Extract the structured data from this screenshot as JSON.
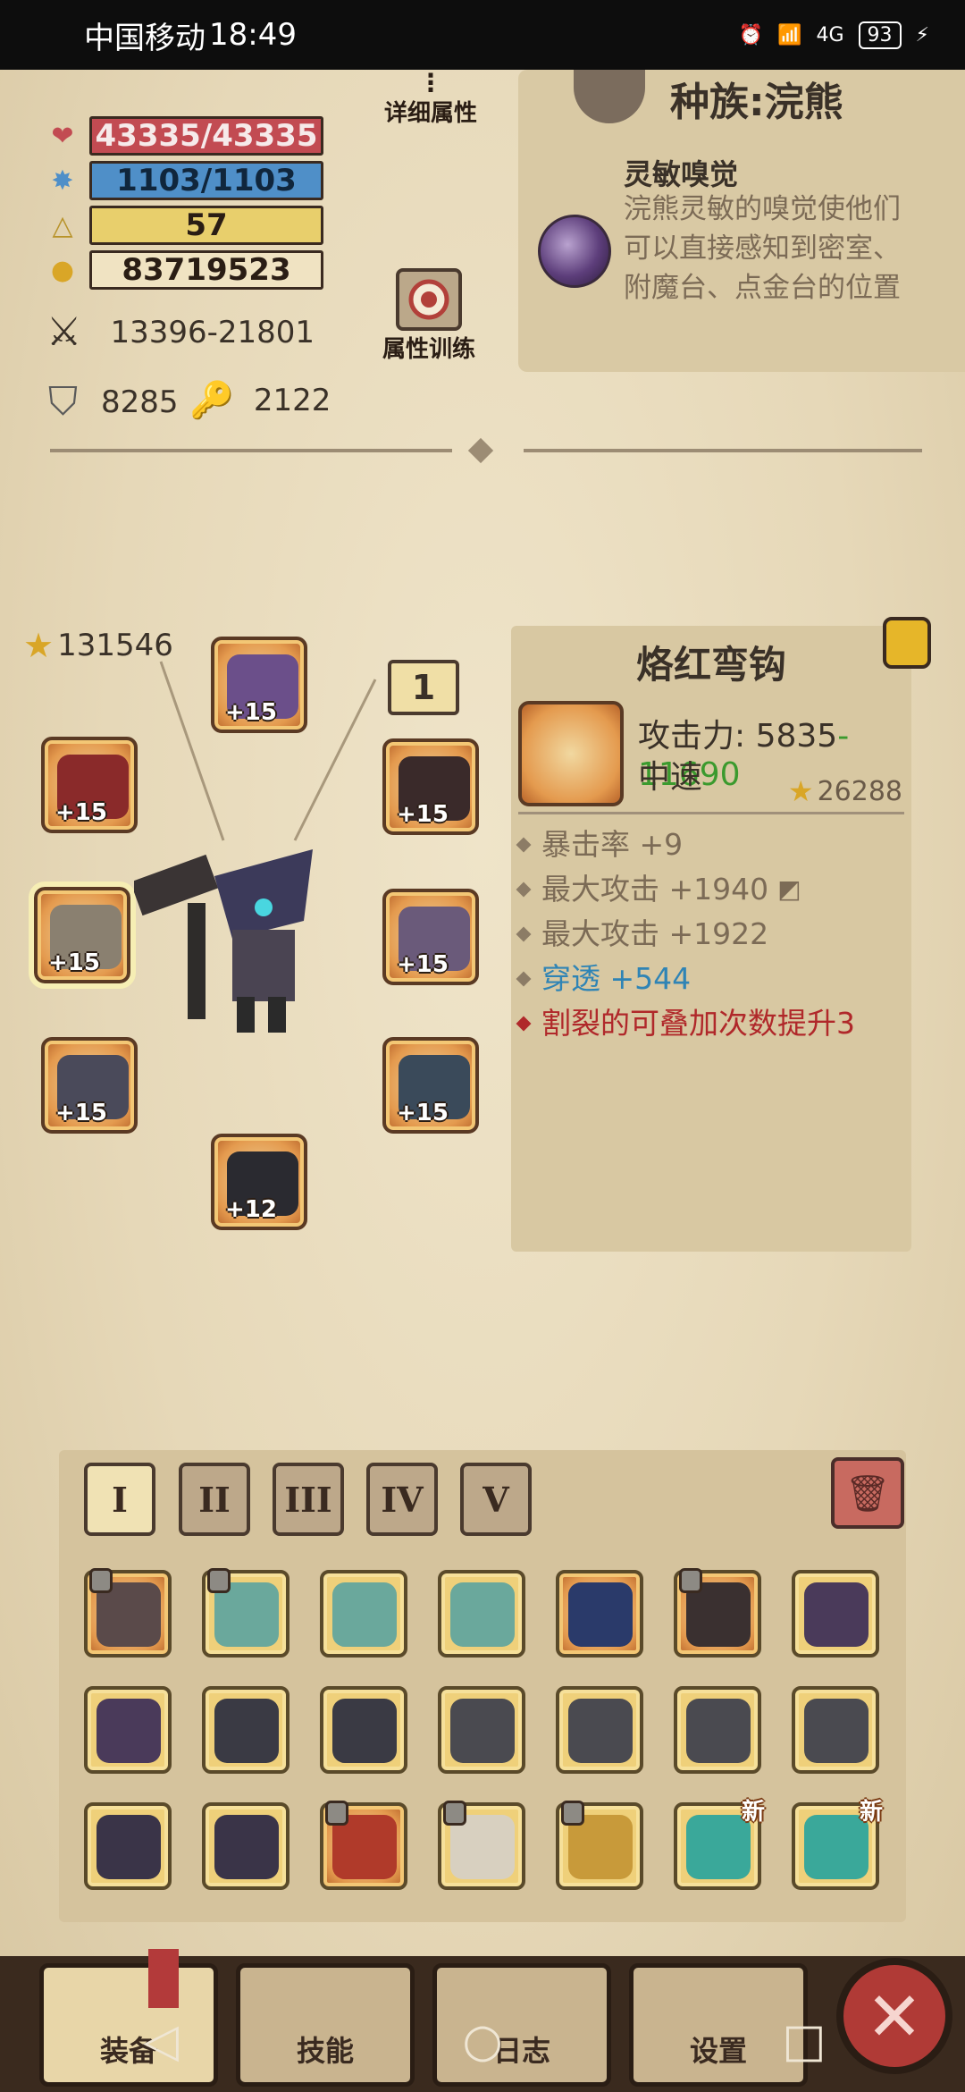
{
  "status_bar": {
    "carrier": "中国移动",
    "time": "18:49",
    "network": "4G",
    "battery": "93"
  },
  "stats": {
    "hp": "43335/43335",
    "mp": "1103/1103",
    "level": "57",
    "gold": "83719523",
    "attack": "13396-21801",
    "defense": "8285",
    "resource": "2122"
  },
  "buttons": {
    "detail_attributes": "详细属性",
    "attribute_training": "属性训练"
  },
  "race": {
    "title": "种族:浣熊",
    "skill_name": "灵敏嗅觉",
    "skill_desc": "浣熊灵敏的嗅觉使他们可以直接感知到密室、附魔台、点金台的位置"
  },
  "equipment": {
    "total_score": "131546",
    "tag": "1",
    "slots": [
      {
        "name": "helmet",
        "level": "+15"
      },
      {
        "name": "amulet",
        "level": "+15"
      },
      {
        "name": "gloves-right",
        "level": "+15"
      },
      {
        "name": "weapon",
        "level": "+15"
      },
      {
        "name": "shoulder",
        "level": "+15"
      },
      {
        "name": "gloves-left",
        "level": "+15"
      },
      {
        "name": "armor",
        "level": "+15"
      },
      {
        "name": "boots",
        "level": "+12"
      }
    ]
  },
  "item_detail": {
    "name": "烙红弯钩",
    "attack_label": "攻击力:",
    "attack_low": "5835",
    "attack_sep": "-",
    "attack_high": "11690",
    "speed": "中速",
    "score": "26288",
    "attributes": [
      {
        "text": "暴击率 +9",
        "color": "normal"
      },
      {
        "text": "最大攻击 +1940",
        "color": "normal"
      },
      {
        "text": "最大攻击 +1922",
        "color": "normal"
      },
      {
        "text": "穿透 +544",
        "color": "blue"
      },
      {
        "text": "割裂的可叠加次数提升3",
        "color": "red"
      }
    ]
  },
  "inventory": {
    "tabs": [
      "I",
      "II",
      "III",
      "IV",
      "V"
    ],
    "new_badge": "新"
  },
  "bottom_nav": {
    "equip": "装备",
    "skill": "技能",
    "log": "日志",
    "settings": "设置"
  },
  "colors": {
    "hp": "#c24b52",
    "mp": "#4f8fc8",
    "level": "#e8cf6c",
    "attack_high": "#3b9a2e",
    "pierce": "#2f84b5",
    "special": "#b0282a"
  }
}
